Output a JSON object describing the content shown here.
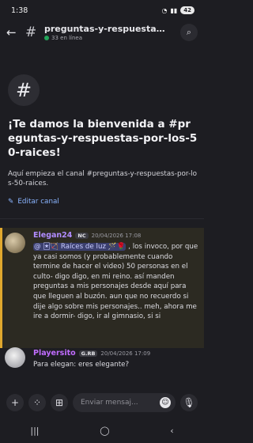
{
  "status": {
    "time": "1:38",
    "battery": "42"
  },
  "header": {
    "channel": "preguntas-y-respuestas-...",
    "online": "33 en línea"
  },
  "welcome": {
    "title": "¡Te damos la bienvenida a #preguntas-y-respuestas-por-los-50-raices!",
    "desc": "Aquí empieza el canal #preguntas-y-respuestas-por-los-50-raices.",
    "edit": "Editar canal"
  },
  "messages": [
    {
      "author": "Elegan24",
      "tag": "NC",
      "time": "20/04/2026 17:08",
      "mention": "@ 🃏🏹 Raíces de luz 🪄🌹",
      "text": " , los invoco, por que ya casi somos (y probablemente cuando termine de hacer el video) 50 personas en el culto- digo digo, en mi reino. así manden preguntas a mis personajes desde aquí para que lleguen al buzón. aun que no recuerdo si dije algo sobre mis personajes.. meh, ahora me ire a dormir- digo, ir al gimnasio, si si"
    },
    {
      "author": "Playersito",
      "tag": "G.RB",
      "time": "20/04/2026 17:09",
      "text": "Para elegan: eres elegante?"
    }
  ],
  "composer": {
    "placeholder": "Enviar mensaj..."
  },
  "colors": {
    "accent": "#8ab4ff",
    "highlight": "#e0a82e",
    "online": "#23a55a"
  }
}
